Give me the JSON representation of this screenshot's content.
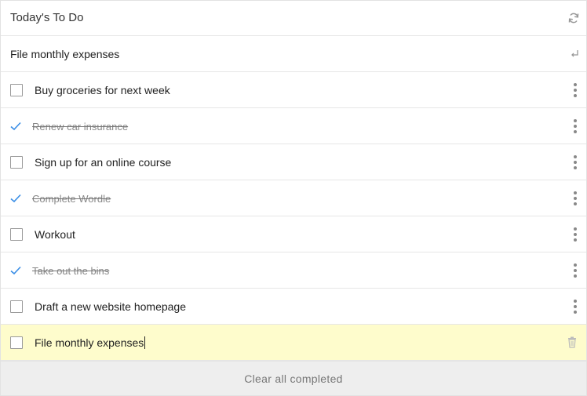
{
  "header": {
    "title": "Today's To Do",
    "refresh_icon": "refresh-icon"
  },
  "new_todo": {
    "value": "File monthly expenses",
    "enter_icon": "enter-icon"
  },
  "todos": [
    {
      "label": "Buy groceries for next week",
      "completed": false
    },
    {
      "label": "Renew car insurance",
      "completed": true
    },
    {
      "label": "Sign up for an online course",
      "completed": false
    },
    {
      "label": "Complete Wordle",
      "completed": true
    },
    {
      "label": "Workout",
      "completed": false
    },
    {
      "label": "Take out the bins",
      "completed": true
    },
    {
      "label": "Draft a new website homepage",
      "completed": false
    },
    {
      "label": "File monthly expenses",
      "completed": false,
      "editing": true
    }
  ],
  "footer": {
    "clear_label": "Clear all completed"
  },
  "colors": {
    "accent": "#3a8ee6",
    "editing_bg": "#fefccc",
    "footer_bg": "#eeeeee"
  }
}
